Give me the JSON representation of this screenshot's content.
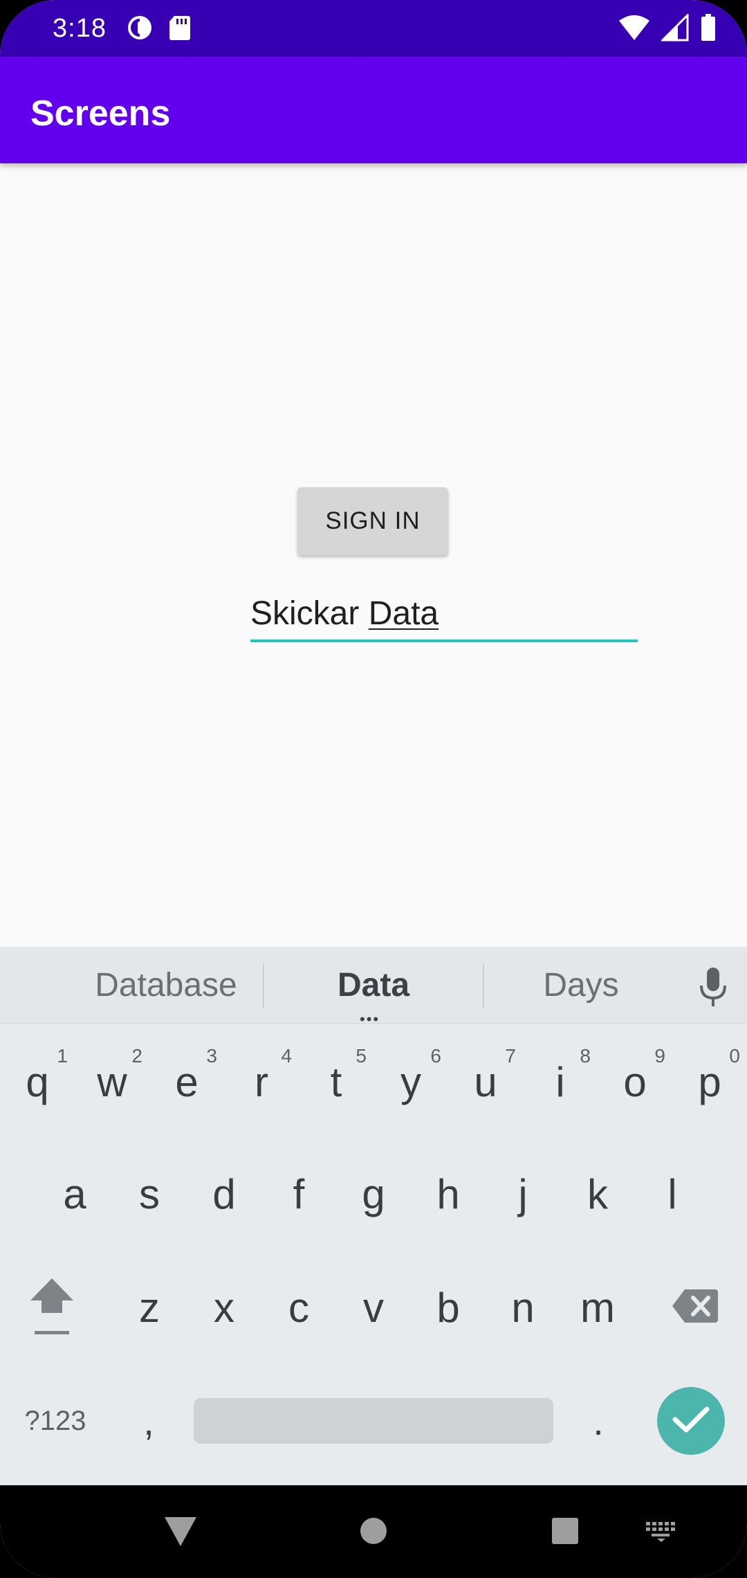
{
  "status_bar": {
    "time": "3:18",
    "left_icons": [
      "data-saver-icon",
      "sd-card-icon"
    ],
    "right_icons": [
      "wifi-icon",
      "cell-signal-icon",
      "battery-icon"
    ]
  },
  "app_bar": {
    "title": "Screens"
  },
  "main": {
    "sign_in_label": "SIGN IN",
    "text_field": {
      "plain": "Skickar ",
      "composing": "Data"
    }
  },
  "keyboard": {
    "suggestions": [
      "Database",
      "Data",
      "Days"
    ],
    "selected_suggestion": "Data",
    "row1": [
      {
        "key": "q",
        "hint": "1"
      },
      {
        "key": "w",
        "hint": "2"
      },
      {
        "key": "e",
        "hint": "3"
      },
      {
        "key": "r",
        "hint": "4"
      },
      {
        "key": "t",
        "hint": "5"
      },
      {
        "key": "y",
        "hint": "6"
      },
      {
        "key": "u",
        "hint": "7"
      },
      {
        "key": "i",
        "hint": "8"
      },
      {
        "key": "o",
        "hint": "9"
      },
      {
        "key": "p",
        "hint": "0"
      }
    ],
    "row2": [
      "a",
      "s",
      "d",
      "f",
      "g",
      "h",
      "j",
      "k",
      "l"
    ],
    "row3": [
      "z",
      "x",
      "c",
      "v",
      "b",
      "n",
      "m"
    ],
    "symbols_label": "?123",
    "comma": ",",
    "period": ".",
    "icons": [
      "mic-icon",
      "shift-icon",
      "backspace-icon",
      "check-icon"
    ]
  },
  "nav_bar": {
    "icons": [
      "back-icon",
      "home-icon",
      "recents-icon",
      "keyboard-switch-icon"
    ]
  },
  "colors": {
    "status_bar": "#3700b3",
    "app_bar": "#6200ee",
    "field_underline": "#1ec8c0",
    "enter_key": "#4db6ac"
  }
}
